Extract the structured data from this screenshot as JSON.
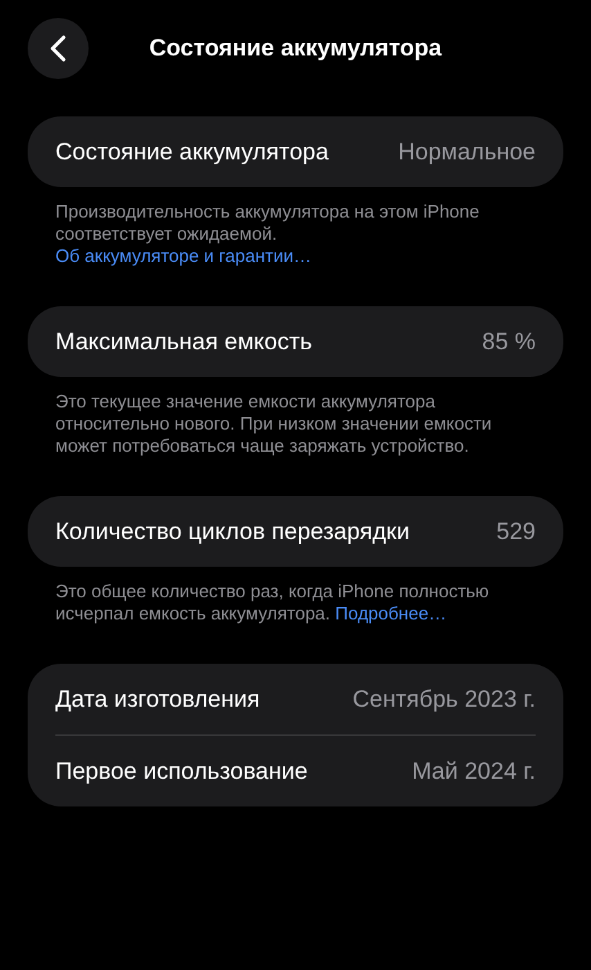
{
  "header": {
    "title": "Состояние аккумулятора"
  },
  "sections": [
    {
      "rows": [
        {
          "label": "Состояние аккумулятора",
          "value": "Нормальное"
        }
      ],
      "footnote": [
        {
          "kind": "text",
          "text": "Производительность аккумулятора на этом iPhone соответствует ожидаемой."
        },
        {
          "kind": "link",
          "text": "Об аккумуляторе и гарантии…"
        }
      ]
    },
    {
      "rows": [
        {
          "label": "Максимальная емкость",
          "value": "85 %"
        }
      ],
      "footnote": [
        {
          "kind": "text",
          "text": "Это текущее значение емкости аккумулятора относительно нового. При низком значении емкости может потребоваться чаще заряжать устройство."
        }
      ]
    },
    {
      "rows": [
        {
          "label": "Количество циклов перезарядки",
          "value": "529"
        }
      ],
      "footnote": [
        {
          "kind": "text",
          "text": "Это общее количество раз, когда iPhone полностью исчерпал емкость аккумулятора."
        },
        {
          "kind": "link",
          "text": "Подробнее…"
        }
      ]
    },
    {
      "rows": [
        {
          "label": "Дата изготовления",
          "value": "Сентябрь 2023 г."
        },
        {
          "label": "Первое использование",
          "value": "Май 2024 г."
        }
      ]
    }
  ]
}
